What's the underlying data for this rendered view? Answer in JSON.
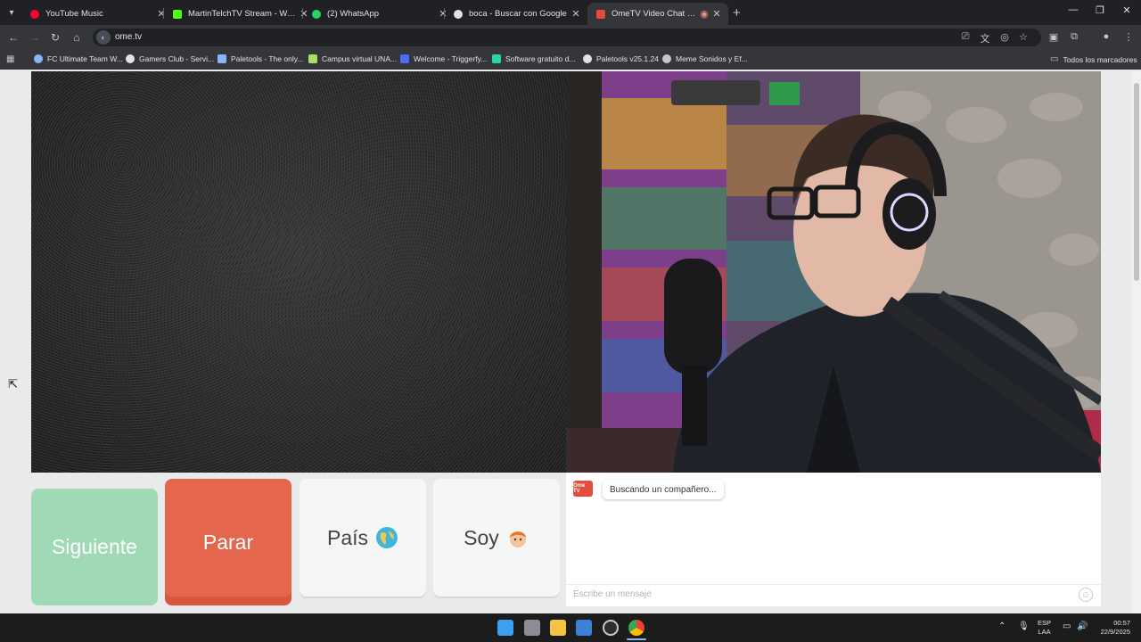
{
  "tabs": [
    {
      "label": "YouTube Music",
      "color": "#ff0033"
    },
    {
      "label": "MartinTelchTV Stream - Watch",
      "color": "#53fc18"
    },
    {
      "label": "(2) WhatsApp",
      "color": "#25d366"
    },
    {
      "label": "boca - Buscar con Google",
      "color": "#e3e3e3"
    },
    {
      "label": "OmeTV Video Chat — Ome",
      "color": "#e34b3a"
    }
  ],
  "address": {
    "url": "ome.tv"
  },
  "bookmarks": [
    {
      "label": "FC Ultimate Team W...",
      "color": "#8ab4f8"
    },
    {
      "label": "Gamers Club - Servi...",
      "color": "#e3e3e3"
    },
    {
      "label": "Paletools - The only...",
      "color": "#8ab4f8"
    },
    {
      "label": "Campus virtual UNA...",
      "color": "#a8e063"
    },
    {
      "label": "Welcome - Triggerfy...",
      "color": "#4a6cf7"
    },
    {
      "label": "Software gratuito d...",
      "color": "#2bd4a8"
    },
    {
      "label": "Paletools v25.1.24",
      "color": "#e3e3e3"
    },
    {
      "label": "Meme Sonidos y Ef...",
      "color": "#c4c7c5"
    }
  ],
  "bookmarks_all": "Todos los marcadores",
  "controls": {
    "next": "Siguiente",
    "stop": "Parar",
    "country": "País",
    "soy": "Soy"
  },
  "chat": {
    "logo": "Ome TV",
    "status": "Buscando un compañero...",
    "placeholder": "Escribe un mensaje"
  },
  "taskbar": {
    "lang_top": "ESP",
    "lang_bottom": "LAA",
    "time": "00:57",
    "date": "22/9/2025"
  },
  "colors": {
    "next": "#9fd9b6",
    "stop": "#e4674d",
    "page_bg": "#e9eaec"
  }
}
